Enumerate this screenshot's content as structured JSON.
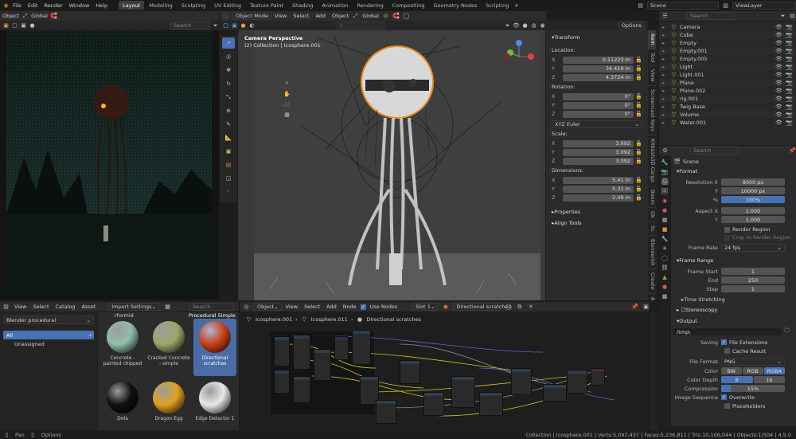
{
  "topbar": {
    "menus": [
      "File",
      "Edit",
      "Render",
      "Window",
      "Help"
    ],
    "workspaces": [
      "Layout",
      "Modeling",
      "Sculpting",
      "UV Editing",
      "Texture Paint",
      "Shading",
      "Animation",
      "Rendering",
      "Compositing",
      "Geometry Nodes",
      "Scripting"
    ],
    "active_workspace": "Layout",
    "scene": "Scene",
    "view_layer": "ViewLayer"
  },
  "render_view": {
    "header": {
      "mode": "Object",
      "orientation": "Global",
      "search_placeholder": "Search"
    }
  },
  "viewport": {
    "header": {
      "mode": "Object Mode",
      "menus": [
        "View",
        "Select",
        "Add",
        "Object"
      ],
      "orientation": "Global",
      "options": "Options"
    },
    "title": "Camera Perspective",
    "collection": "(2) Collection | Icosphere.001"
  },
  "n_panel": {
    "transform_title": "Transform",
    "location_label": "Location:",
    "rotation_label": "Rotation:",
    "scale_label": "Scale:",
    "dimensions_label": "Dimensions:",
    "location": [
      {
        "axis": "X",
        "value": "0.11223 m"
      },
      {
        "axis": "Y",
        "value": "34.419 m"
      },
      {
        "axis": "Z",
        "value": "4.3724 m"
      }
    ],
    "rotation": [
      {
        "axis": "X",
        "value": "0°"
      },
      {
        "axis": "Y",
        "value": "0°"
      },
      {
        "axis": "Z",
        "value": "0°"
      }
    ],
    "rotation_mode": "XYZ Euler",
    "scale": [
      {
        "axis": "X",
        "value": "3.092"
      },
      {
        "axis": "Y",
        "value": "3.092"
      },
      {
        "axis": "Z",
        "value": "3.092"
      }
    ],
    "dimensions": [
      {
        "axis": "X",
        "value": "5.41 m"
      },
      {
        "axis": "Y",
        "value": "5.31 m"
      },
      {
        "axis": "Z",
        "value": "2.49 m"
      }
    ],
    "properties_title": "Properties",
    "align_title": "Align Tools",
    "side_tabs": [
      "Item",
      "Tool",
      "View",
      "Screencast Keys",
      "Kitbash3D Cargo",
      "Boom",
      "Gk",
      "Sc",
      "Blenderkit",
      "Create",
      "Anim"
    ]
  },
  "outliner": {
    "search_placeholder": "Search",
    "items": [
      {
        "name": "Camera",
        "color": "#e0a040"
      },
      {
        "name": "Cube",
        "color": "#e0a040"
      },
      {
        "name": "Empty",
        "color": "#e0a040"
      },
      {
        "name": "Empty.001",
        "color": "#e0a040"
      },
      {
        "name": "Empty.005",
        "color": "#e0a040"
      },
      {
        "name": "Light",
        "color": "#e0a040"
      },
      {
        "name": "Light.001",
        "color": "#e0a040"
      },
      {
        "name": "Plane",
        "color": "#e0a040"
      },
      {
        "name": "Plane.002",
        "color": "#e0a040"
      },
      {
        "name": "rig.001",
        "color": "#e0a040"
      },
      {
        "name": "Twig Base",
        "color": "#e0a040"
      },
      {
        "name": "Volume",
        "color": "#e0a040"
      },
      {
        "name": "Water.001",
        "color": "#e0a040"
      }
    ]
  },
  "properties": {
    "search_placeholder": "Search",
    "scene": "Scene",
    "format_title": "Format",
    "res_x_label": "Resolution X",
    "res_x": "8000 px",
    "res_y_label": "Y",
    "res_y": "10000 px",
    "pct_label": "%",
    "pct": "100%",
    "aspect_x_label": "Aspect X",
    "aspect_x": "1.000",
    "aspect_y_label": "Y",
    "aspect_y": "1.000",
    "render_region": "Render Region",
    "crop_region": "Crop to Render Region",
    "frame_rate_label": "Frame Rate",
    "frame_rate": "24 fps",
    "frame_range_title": "Frame Range",
    "frame_start_label": "Frame Start",
    "frame_start": "1",
    "end_label": "End",
    "end": "250",
    "step_label": "Step",
    "step": "1",
    "time_stretching": "Time Stretching",
    "stereoscopy": "Stereoscopy",
    "output_title": "Output",
    "output_path": "/tmp\\",
    "saving_label": "Saving",
    "file_ext": "File Extensions",
    "cache_result": "Cache Result",
    "file_format_label": "File Format",
    "file_format": "PNG",
    "color_label": "Color",
    "color_opts": [
      "BW",
      "RGB",
      "RGBA"
    ],
    "color_depth_label": "Color Depth",
    "depth_opts": [
      "8",
      "16"
    ],
    "compression_label": "Compression",
    "compression": "15%",
    "compression_fraction": 0.15,
    "image_seq_label": "Image Sequence",
    "overwrite": "Overwrite",
    "placeholders": "Placeholders"
  },
  "asset_browser": {
    "menus": [
      "View",
      "Select",
      "Catalog",
      "Asset"
    ],
    "import_settings": "Import Settings",
    "search_placeholder": "Search",
    "library": "Blender procedural",
    "catalog_all": "All",
    "catalog_unassigned": "Unassigned",
    "assets": [
      {
        "name": "Concrete - painted chipped",
        "color": "#8fbfa8"
      },
      {
        "name": "Cracked Concrete - simple",
        "color": "#9aa86a"
      },
      {
        "name": "Directional scratches",
        "color": "#c8401a"
      },
      {
        "name": "Dots",
        "color": "#111111"
      },
      {
        "name": "Dragon Egg",
        "color": "#e0a020"
      },
      {
        "name": "Edge Detector 1",
        "color": "#e8e8e8"
      }
    ],
    "top_labels": [
      "rformid",
      "Procedural Simple"
    ]
  },
  "node_editor": {
    "mode": "Object",
    "menus": [
      "View",
      "Select",
      "Add",
      "Node"
    ],
    "use_nodes": "Use Nodes",
    "slot": "Slot 1",
    "material": "Directional scratches",
    "breadcrumb": [
      "Icosphere.001",
      "Icosphere.011",
      "Directional scratches"
    ]
  },
  "status_bar": {
    "pan": "Pan",
    "options": "Options",
    "stats": "Collection | Icosphere.001 | Verts:5,097,437 | Faces:5,236,811 | Tris:10,106,044 | Objects:1/504 | 4.5.0"
  }
}
